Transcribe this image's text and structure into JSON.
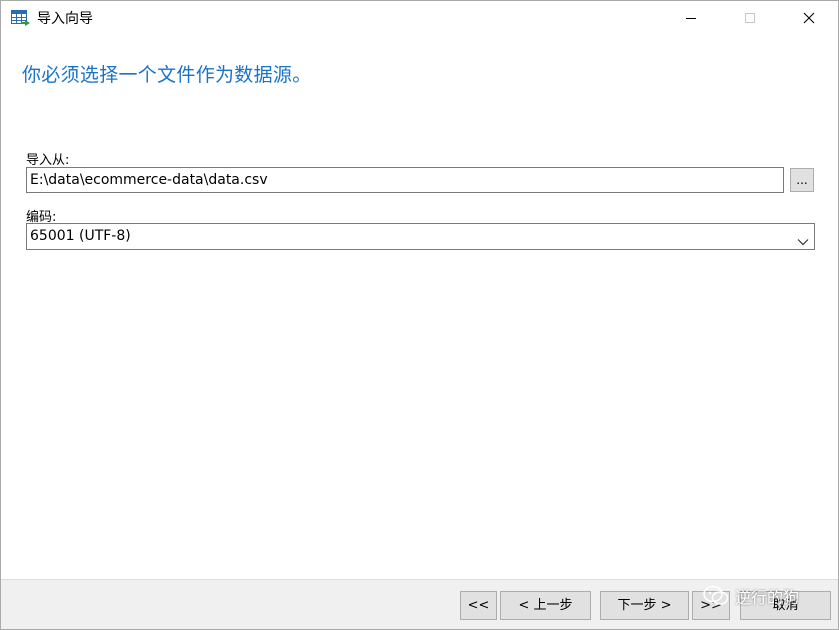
{
  "window": {
    "title": "导入向导",
    "icon": "table-import-icon"
  },
  "heading": "你必须选择一个文件作为数据源。",
  "form": {
    "import_from_label": "导入从:",
    "import_from_value": "E:\\data\\ecommerce-data\\data.csv",
    "browse_label": "...",
    "encoding_label": "编码:",
    "encoding_value": "65001 (UTF-8)"
  },
  "footer": {
    "first_label": "<<",
    "prev_label": "< 上一步",
    "next_label": "下一步 >",
    "last_label": ">>",
    "cancel_label": "取消"
  },
  "watermark": {
    "text": "逆行的狗",
    "icon": "wechat-icon"
  },
  "colors": {
    "heading": "#1a73c8",
    "footer_bg": "#f0f0f0",
    "button_bg": "#e1e1e1"
  }
}
